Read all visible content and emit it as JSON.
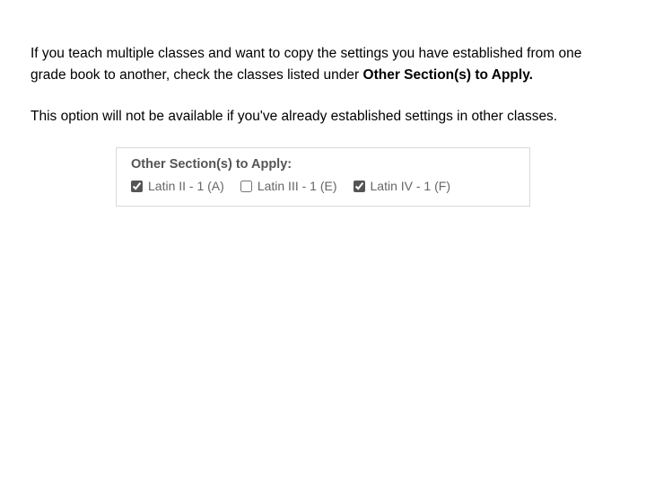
{
  "para1": {
    "text_a": "If you teach multiple classes and want to copy the settings you have established from one grade book to another, check the classes listed under ",
    "bold": "Other Section(s) to Apply."
  },
  "para2": "This option will not be available if you've already established settings in other classes.",
  "panel": {
    "title": "Other Section(s) to Apply:",
    "options": [
      {
        "label": "Latin II - 1 (A)",
        "checked": true
      },
      {
        "label": "Latin III - 1 (E)",
        "checked": false
      },
      {
        "label": "Latin IV - 1 (F)",
        "checked": true
      }
    ]
  }
}
